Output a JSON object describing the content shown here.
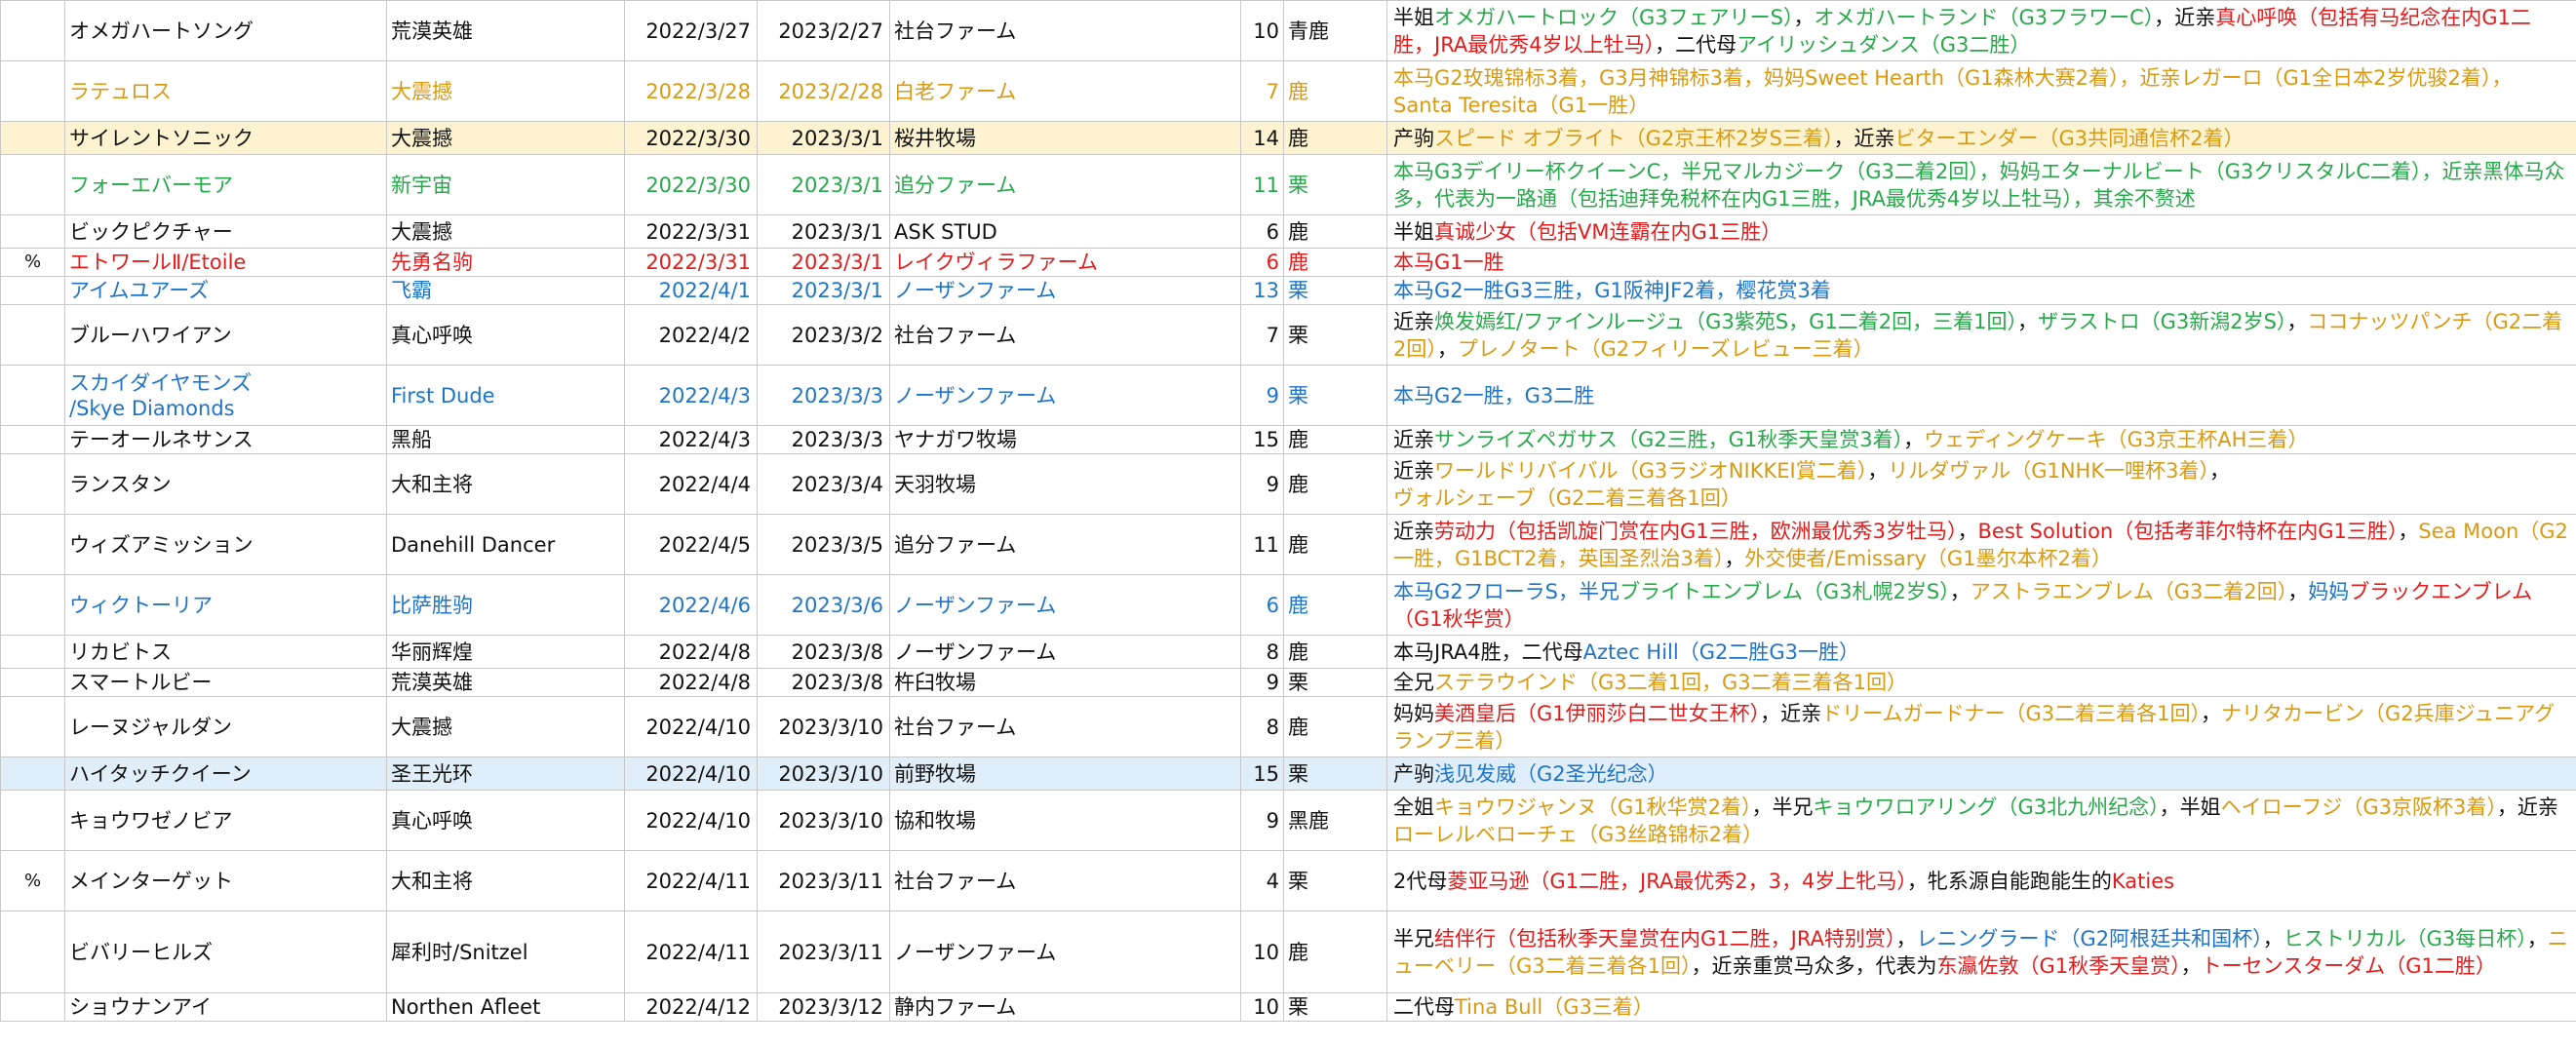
{
  "rows": [
    {
      "mark": "",
      "name": "オメガハートソング",
      "sire": "荒漠英雄",
      "d1": "2022/3/27",
      "d2": "2023/2/27",
      "farm": "社台ファーム",
      "num": "10",
      "coat": "青鹿",
      "color": "default",
      "hl": "",
      "h": 62,
      "notes": [
        {
          "t": "半姐",
          "c": "default"
        },
        {
          "t": "オメガハートロック（G3フェアリーS）",
          "c": "green"
        },
        {
          "t": "，",
          "c": "default"
        },
        {
          "t": "オメガハートランド（G3フラワーC）",
          "c": "green"
        },
        {
          "t": "，近亲",
          "c": "default"
        },
        {
          "t": "真心呼唤（包括有马纪念在内G1二胜，JRA最优秀4岁以上牡马）",
          "c": "red"
        },
        {
          "t": "，二代母",
          "c": "default"
        },
        {
          "t": "アイリッシュダンス（G3二胜）",
          "c": "green"
        }
      ]
    },
    {
      "mark": "",
      "name": "ラテュロス",
      "sire": "大震撼",
      "d1": "2022/3/28",
      "d2": "2023/2/28",
      "farm": "白老ファーム",
      "num": "7",
      "coat": "鹿",
      "color": "orange",
      "hl": "",
      "h": 62,
      "notes": [
        {
          "t": "本马G2玫瑰锦标3着，G3月神锦标3着，妈妈Sweet Hearth（G1森林大赛2着），近亲レガーロ（G1全日本2岁优骏2着），Santa Teresita（G1一胜）",
          "c": "orange"
        }
      ]
    },
    {
      "mark": "",
      "name": "サイレントソニック",
      "sire": "大震撼",
      "d1": "2022/3/30",
      "d2": "2023/3/1",
      "farm": "桜井牧場",
      "num": "14",
      "coat": "鹿",
      "color": "default",
      "hl": "yellow",
      "h": 34,
      "notes": [
        {
          "t": "产驹",
          "c": "default"
        },
        {
          "t": "スピード オブライト（G2京王杯2岁S三着）",
          "c": "orange"
        },
        {
          "t": "，近亲",
          "c": "default"
        },
        {
          "t": "ビターエンダー（G3共同通信杯2着）",
          "c": "orange"
        }
      ]
    },
    {
      "mark": "",
      "name": "フォーエバーモア",
      "sire": "新宇宙",
      "d1": "2022/3/30",
      "d2": "2023/3/1",
      "farm": "追分ファーム",
      "num": "11",
      "coat": "栗",
      "color": "green",
      "hl": "",
      "h": 62,
      "notes": [
        {
          "t": "本马G3デイリー杯クイーンC，半兄マルカジーク（G3二着2回），妈妈エターナルビート（G3クリスタルC二着），近亲黑体马众多，代表为一路通（包括迪拜免税杯在内G1三胜，JRA最优秀4岁以上牡马），其余不赘述",
          "c": "green"
        }
      ]
    },
    {
      "mark": "",
      "name": "ビックピクチャー",
      "sire": "大震撼",
      "d1": "2022/3/31",
      "d2": "2023/3/1",
      "farm": "ASK STUD",
      "num": "6",
      "coat": "鹿",
      "color": "default",
      "hl": "",
      "h": 34,
      "notes": [
        {
          "t": "半姐",
          "c": "default"
        },
        {
          "t": "真诚少女（包括VM连霸在内G1三胜）",
          "c": "red"
        }
      ]
    },
    {
      "mark": "%",
      "name": "エトワールⅡ/Etoile",
      "sire": "先勇名驹",
      "d1": "2022/3/31",
      "d2": "2023/3/1",
      "farm": "レイクヴィラファーム",
      "num": "6",
      "coat": "鹿",
      "color": "red",
      "hl": "",
      "h": 28,
      "notes": [
        {
          "t": "本马G1一胜",
          "c": "red"
        }
      ]
    },
    {
      "mark": "",
      "name": "アイムユアーズ",
      "sire": "飞霸",
      "d1": "2022/4/1",
      "d2": "2023/3/1",
      "farm": "ノーザンファーム",
      "num": "13",
      "coat": "栗",
      "color": "blue",
      "hl": "",
      "h": 28,
      "notes": [
        {
          "t": "本马G2一胜G3三胜，G1阪神JF2着，樱花赏3着",
          "c": "blue"
        }
      ]
    },
    {
      "mark": "",
      "name": "ブルーハワイアン",
      "sire": "真心呼唤",
      "d1": "2022/4/2",
      "d2": "2023/3/2",
      "farm": "社台ファーム",
      "num": "7",
      "coat": "栗",
      "color": "default",
      "hl": "",
      "h": 62,
      "notes": [
        {
          "t": "近亲",
          "c": "default"
        },
        {
          "t": "焕发嫣红/ファインルージュ（G3紫苑S，G1二着2回，三着1回）",
          "c": "green"
        },
        {
          "t": "，",
          "c": "default"
        },
        {
          "t": "ザラストロ（G3新潟2岁S）",
          "c": "green"
        },
        {
          "t": "，",
          "c": "default"
        },
        {
          "t": "ココナッツパンチ（G2二着2回）",
          "c": "orange"
        },
        {
          "t": "，",
          "c": "default"
        },
        {
          "t": "プレノタート（G2フィリーズレビュー三着）",
          "c": "orange"
        }
      ]
    },
    {
      "mark": "",
      "name": "スカイダイヤモンズ\n/Skye Diamonds",
      "sire": "First Dude",
      "d1": "2022/4/3",
      "d2": "2023/3/3",
      "farm": "ノーザンファーム",
      "num": "9",
      "coat": "栗",
      "color": "blue",
      "hl": "",
      "h": 62,
      "notes": [
        {
          "t": "本马G2一胜，G3二胜",
          "c": "blue"
        }
      ]
    },
    {
      "mark": "",
      "name": "テーオールネサンス",
      "sire": "黑船",
      "d1": "2022/4/3",
      "d2": "2023/3/3",
      "farm": "ヤナガワ牧場",
      "num": "15",
      "coat": "鹿",
      "color": "default",
      "hl": "",
      "h": 28,
      "notes": [
        {
          "t": "近亲",
          "c": "default"
        },
        {
          "t": "サンライズペガサス（G2三胜，G1秋季天皇赏3着）",
          "c": "green"
        },
        {
          "t": "，",
          "c": "default"
        },
        {
          "t": "ウェディングケーキ（G3京王杯AH三着）",
          "c": "orange"
        }
      ]
    },
    {
      "mark": "",
      "name": "ランスタン",
      "sire": "大和主将",
      "d1": "2022/4/4",
      "d2": "2023/3/4",
      "farm": "天羽牧場",
      "num": "9",
      "coat": "鹿",
      "color": "default",
      "hl": "",
      "h": 62,
      "notes": [
        {
          "t": "近亲",
          "c": "default"
        },
        {
          "t": "ワールドリバイバル（G3ラジオNIKKEI賞二着）",
          "c": "orange"
        },
        {
          "t": "，",
          "c": "default"
        },
        {
          "t": "リルダヴァル（G1NHK一哩杯3着）",
          "c": "orange"
        },
        {
          "t": "，",
          "c": "default"
        },
        {
          "t": "ヴォルシェーブ（G2二着三着各1回）",
          "c": "orange"
        }
      ]
    },
    {
      "mark": "",
      "name": "ウィズアミッション",
      "sire": "Danehill Dancer",
      "d1": "2022/4/5",
      "d2": "2023/3/5",
      "farm": "追分ファーム",
      "num": "11",
      "coat": "鹿",
      "color": "default",
      "hl": "",
      "h": 62,
      "notes": [
        {
          "t": "近亲",
          "c": "default"
        },
        {
          "t": "劳动力（包括凯旋门赏在内G1三胜，欧洲最优秀3岁牡马）",
          "c": "red"
        },
        {
          "t": "，",
          "c": "default"
        },
        {
          "t": "Best Solution（包括考菲尔特杯在内G1三胜）",
          "c": "red"
        },
        {
          "t": "，",
          "c": "default"
        },
        {
          "t": "Sea Moon（G2一胜，G1BCT2着，英国圣烈治3着）",
          "c": "orange"
        },
        {
          "t": "，",
          "c": "default"
        },
        {
          "t": "外交使者/Emissary（G1墨尔本杯2着）",
          "c": "orange"
        }
      ]
    },
    {
      "mark": "",
      "name": "ウィクトーリア",
      "sire": "比萨胜驹",
      "d1": "2022/4/6",
      "d2": "2023/3/6",
      "farm": "ノーザンファーム",
      "num": "6",
      "coat": "鹿",
      "color": "blue",
      "hl": "",
      "h": 62,
      "notes": [
        {
          "t": "本马G2フローラS，半兄",
          "c": "blue"
        },
        {
          "t": "ブライトエンブレム（G3札幌2岁S）",
          "c": "green"
        },
        {
          "t": "，",
          "c": "default"
        },
        {
          "t": "アストラエンブレム（G3二着2回）",
          "c": "orange"
        },
        {
          "t": "，",
          "c": "default"
        },
        {
          "t": "妈妈",
          "c": "blue"
        },
        {
          "t": "ブラックエンブレム（G1秋华赏）",
          "c": "red"
        }
      ]
    },
    {
      "mark": "",
      "name": "リカビトス",
      "sire": "华丽辉煌",
      "d1": "2022/4/8",
      "d2": "2023/3/8",
      "farm": "ノーザンファーム",
      "num": "8",
      "coat": "鹿",
      "color": "default",
      "hl": "",
      "h": 34,
      "notes": [
        {
          "t": "本马JRA4胜，二代母",
          "c": "default"
        },
        {
          "t": "Aztec Hill（G2二胜G3一胜）",
          "c": "blue"
        }
      ]
    },
    {
      "mark": "",
      "name": "スマートルビー",
      "sire": "荒漠英雄",
      "d1": "2022/4/8",
      "d2": "2023/3/8",
      "farm": "杵臼牧場",
      "num": "9",
      "coat": "栗",
      "color": "default",
      "hl": "",
      "h": 28,
      "notes": [
        {
          "t": "全兄",
          "c": "default"
        },
        {
          "t": "ステラウインド（G3二着1回，G3二着三着各1回）",
          "c": "orange"
        }
      ]
    },
    {
      "mark": "",
      "name": "レーヌジャルダン",
      "sire": "大震撼",
      "d1": "2022/4/10",
      "d2": "2023/3/10",
      "farm": "社台ファーム",
      "num": "8",
      "coat": "鹿",
      "color": "default",
      "hl": "",
      "h": 62,
      "notes": [
        {
          "t": "妈妈",
          "c": "default"
        },
        {
          "t": "美酒皇后（G1伊丽莎白二世女王杯）",
          "c": "red"
        },
        {
          "t": "，近亲",
          "c": "default"
        },
        {
          "t": "ドリームガードナー（G3二着三着各1回）",
          "c": "orange"
        },
        {
          "t": "，",
          "c": "default"
        },
        {
          "t": "ナリタカービン（G2兵庫ジュニアグランプ三着）",
          "c": "orange"
        }
      ]
    },
    {
      "mark": "",
      "name": "ハイタッチクイーン",
      "sire": "圣王光环",
      "d1": "2022/4/10",
      "d2": "2023/3/10",
      "farm": "前野牧場",
      "num": "15",
      "coat": "栗",
      "color": "default",
      "hl": "blue",
      "h": 34,
      "notes": [
        {
          "t": "产驹",
          "c": "default"
        },
        {
          "t": "浅见发威（G2圣光纪念）",
          "c": "blue"
        }
      ]
    },
    {
      "mark": "",
      "name": "キョウワゼノビア",
      "sire": "真心呼唤",
      "d1": "2022/4/10",
      "d2": "2023/3/10",
      "farm": "協和牧場",
      "num": "9",
      "coat": "黑鹿",
      "color": "default",
      "hl": "",
      "h": 62,
      "notes": [
        {
          "t": "全姐",
          "c": "default"
        },
        {
          "t": "キョウワジャンヌ（G1秋华赏2着）",
          "c": "orange"
        },
        {
          "t": "，半兄",
          "c": "default"
        },
        {
          "t": "キョウワロアリング（G3北九州纪念）",
          "c": "green"
        },
        {
          "t": "，半姐",
          "c": "default"
        },
        {
          "t": "ヘイローフジ（G3京阪杯3着）",
          "c": "orange"
        },
        {
          "t": "，近亲",
          "c": "default"
        },
        {
          "t": "ローレルベローチェ（G3丝路锦标2着）",
          "c": "orange"
        }
      ]
    },
    {
      "mark": "%",
      "name": "メインターゲット",
      "sire": "大和主将",
      "d1": "2022/4/11",
      "d2": "2023/3/11",
      "farm": "社台ファーム",
      "num": "4",
      "coat": "栗",
      "color": "default",
      "hl": "",
      "h": 62,
      "notes": [
        {
          "t": "2代母",
          "c": "default"
        },
        {
          "t": "菱亚马逊（G1二胜，JRA最优秀2，3，4岁上牝马）",
          "c": "red"
        },
        {
          "t": "，牝系源自能跑能生的",
          "c": "default"
        },
        {
          "t": "Katies",
          "c": "red"
        }
      ]
    },
    {
      "mark": "",
      "name": "ビバリーヒルズ",
      "sire": "犀利时/Snitzel",
      "d1": "2022/4/11",
      "d2": "2023/3/11",
      "farm": "ノーザンファーム",
      "num": "10",
      "coat": "鹿",
      "color": "default",
      "hl": "",
      "h": 84,
      "notes": [
        {
          "t": "半兄",
          "c": "default"
        },
        {
          "t": "结伴行（包括秋季天皇赏在内G1二胜，JRA特别赏）",
          "c": "red"
        },
        {
          "t": "，",
          "c": "default"
        },
        {
          "t": "レニングラード（G2阿根廷共和国杯）",
          "c": "blue"
        },
        {
          "t": "，",
          "c": "default"
        },
        {
          "t": "ヒストリカル（G3每日杯）",
          "c": "green"
        },
        {
          "t": "，",
          "c": "default"
        },
        {
          "t": "ニューベリー（G3二着三着各1回）",
          "c": "orange"
        },
        {
          "t": "，近亲重赏马众多，代表为",
          "c": "default"
        },
        {
          "t": "东瀛佐敦（G1秋季天皇赏）",
          "c": "red"
        },
        {
          "t": "，",
          "c": "default"
        },
        {
          "t": "トーセンスターダム（G1二胜）",
          "c": "red"
        }
      ]
    },
    {
      "mark": "",
      "name": "ショウナンアイ",
      "sire": "Northen Afleet",
      "d1": "2022/4/12",
      "d2": "2023/3/12",
      "farm": "静内ファーム",
      "num": "10",
      "coat": "栗",
      "color": "default",
      "hl": "",
      "h": 28,
      "notes": [
        {
          "t": "二代母",
          "c": "default"
        },
        {
          "t": "Tina Bull（G3三着）",
          "c": "orange"
        }
      ]
    }
  ]
}
